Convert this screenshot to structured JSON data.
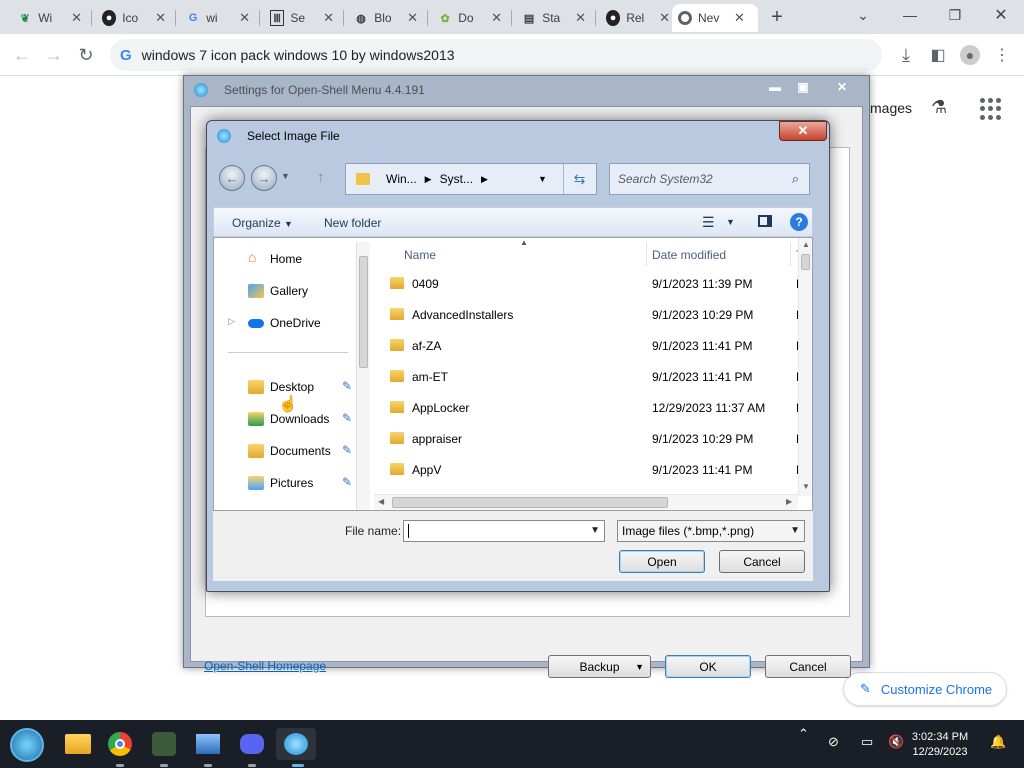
{
  "browser": {
    "tabs": [
      {
        "label": "Wi",
        "icon": "leaf-icon",
        "color": "#1e8e3e"
      },
      {
        "label": "Ico",
        "icon": "github-icon",
        "color": "#222222"
      },
      {
        "label": "wi",
        "icon": "google-icon",
        "color": "#4285f4"
      },
      {
        "label": "Se",
        "icon": "library-icon",
        "color": "#333333"
      },
      {
        "label": "Blo",
        "icon": "globe-icon",
        "color": "#555555"
      },
      {
        "label": "Do",
        "icon": "download-site-icon",
        "color": "#7cb342"
      },
      {
        "label": "Sta",
        "icon": "document-icon",
        "color": "#555555"
      },
      {
        "label": "Rel",
        "icon": "github-icon",
        "color": "#222222"
      },
      {
        "label": "Nev",
        "icon": "chrome-icon",
        "color": "#555555",
        "active": true
      }
    ],
    "new_tab": "+",
    "address": "windows 7 icon pack windows 10 by windows2013",
    "ntp_images_label": "mages",
    "customize_label": "Customize Chrome"
  },
  "settings": {
    "title": "Settings for Open-Shell Menu 4.4.191",
    "homepage_link": "Open-Shell Homepage",
    "backup_label": "Backup",
    "ok_label": "OK",
    "cancel_label": "Cancel"
  },
  "dialog": {
    "title": "Select Image File",
    "close_label": "✕",
    "breadcrumbs": [
      "Win...",
      "Syst..."
    ],
    "search_placeholder": "Search System32",
    "organize_label": "Organize",
    "new_folder_label": "New folder",
    "nav_items": [
      {
        "label": "Home",
        "icon": "home-icon"
      },
      {
        "label": "Gallery",
        "icon": "gallery-icon"
      },
      {
        "label": "OneDrive",
        "icon": "onedrive-icon"
      },
      {
        "label": "Desktop",
        "icon": "desktop-folder-icon"
      },
      {
        "label": "Downloads",
        "icon": "downloads-folder-icon"
      },
      {
        "label": "Documents",
        "icon": "documents-folder-icon"
      },
      {
        "label": "Pictures",
        "icon": "pictures-folder-icon"
      }
    ],
    "columns": {
      "name": "Name",
      "date": "Date modified",
      "type": "Ty"
    },
    "files": [
      {
        "name": "0409",
        "date": "9/1/2023 11:39 PM",
        "type": "Fil"
      },
      {
        "name": "AdvancedInstallers",
        "date": "9/1/2023 10:29 PM",
        "type": "Fil"
      },
      {
        "name": "af-ZA",
        "date": "9/1/2023 11:41 PM",
        "type": "Fil"
      },
      {
        "name": "am-ET",
        "date": "9/1/2023 11:41 PM",
        "type": "Fil"
      },
      {
        "name": "AppLocker",
        "date": "12/29/2023 11:37 AM",
        "type": "Fil"
      },
      {
        "name": "appraiser",
        "date": "9/1/2023 10:29 PM",
        "type": "Fil"
      },
      {
        "name": "AppV",
        "date": "9/1/2023 11:41 PM",
        "type": "Fil"
      }
    ],
    "filename_label": "File name:",
    "filename_value": "",
    "filter_value": "Image files (*.bmp,*.png)",
    "open_label": "Open",
    "cancel_label": "Cancel"
  },
  "taskbar": {
    "time": "3:02:34 PM",
    "date": "12/29/2023"
  },
  "colors": {
    "accent": "#1a73e8",
    "taskbar": "#1a1e26",
    "aero": "#b8c9e0"
  }
}
